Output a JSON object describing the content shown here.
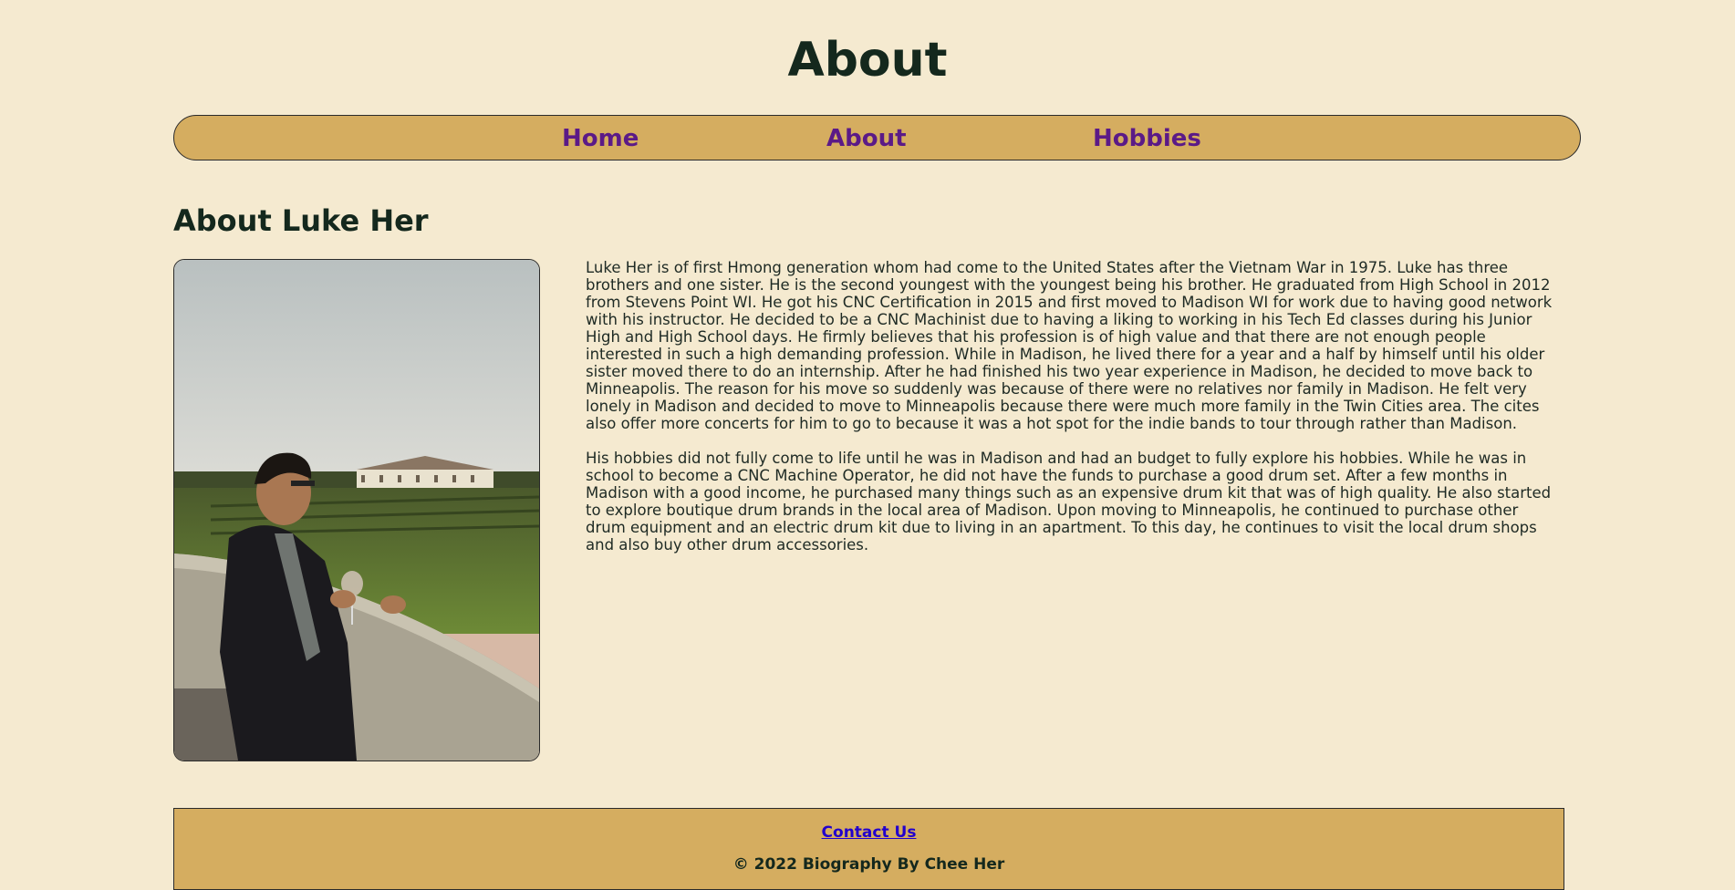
{
  "page": {
    "title": "About"
  },
  "nav": {
    "items": [
      {
        "label": "Home"
      },
      {
        "label": "About"
      },
      {
        "label": "Hobbies"
      }
    ]
  },
  "main": {
    "heading": "About Luke Her",
    "portrait": {
      "description_icon": "portrait-photo"
    },
    "paragraphs": [
      "Luke Her is of first Hmong generation whom had come to the United States after the Vietnam War in 1975. Luke has three brothers and one sister. He is the second youngest with the youngest being his brother. He graduated from High School in 2012 from Stevens Point WI. He got his CNC Certification in 2015 and first moved to Madison WI for work due to having good network with his instructor. He decided to be a CNC Machinist due to having a liking to working in his Tech Ed classes during his Junior High and High School days. He firmly believes that his profession is of high value and that there are not enough people interested in such a high demanding profession. While in Madison, he lived there for a year and a half by himself until his older sister moved there to do an internship. After he had finished his two year experience in Madison, he decided to move back to Minneapolis. The reason for his move so suddenly was because of there were no relatives nor family in Madison. He felt very lonely in Madison and decided to move to Minneapolis because there were much more family in the Twin Cities area. The cites also offer more concerts for him to go to because it was a hot spot for the indie bands to tour through rather than Madison.",
      "His hobbies did not fully come to life until he was in Madison and had an budget to fully explore his hobbies. While he was in school to become a CNC Machine Operator, he did not have the funds to purchase a good drum set. After a few months in Madison with a good income, he purchased many things such as an expensive drum kit that was of high quality. He also started to explore boutique drum brands in the local area of Madison. Upon moving to Minneapolis, he continued to purchase other drum equipment and an electric drum kit due to living in an apartment. To this day, he continues to visit the local drum shops and also buy other drum accessories."
    ]
  },
  "footer": {
    "contact_label": "Contact Us",
    "copyright": "© 2022 Biography By Chee Her"
  },
  "colors": {
    "background": "#f5ead0",
    "accent": "#d5ad60",
    "nav_link": "#5b1a87",
    "heading": "#14281d",
    "link": "#2200cc"
  }
}
